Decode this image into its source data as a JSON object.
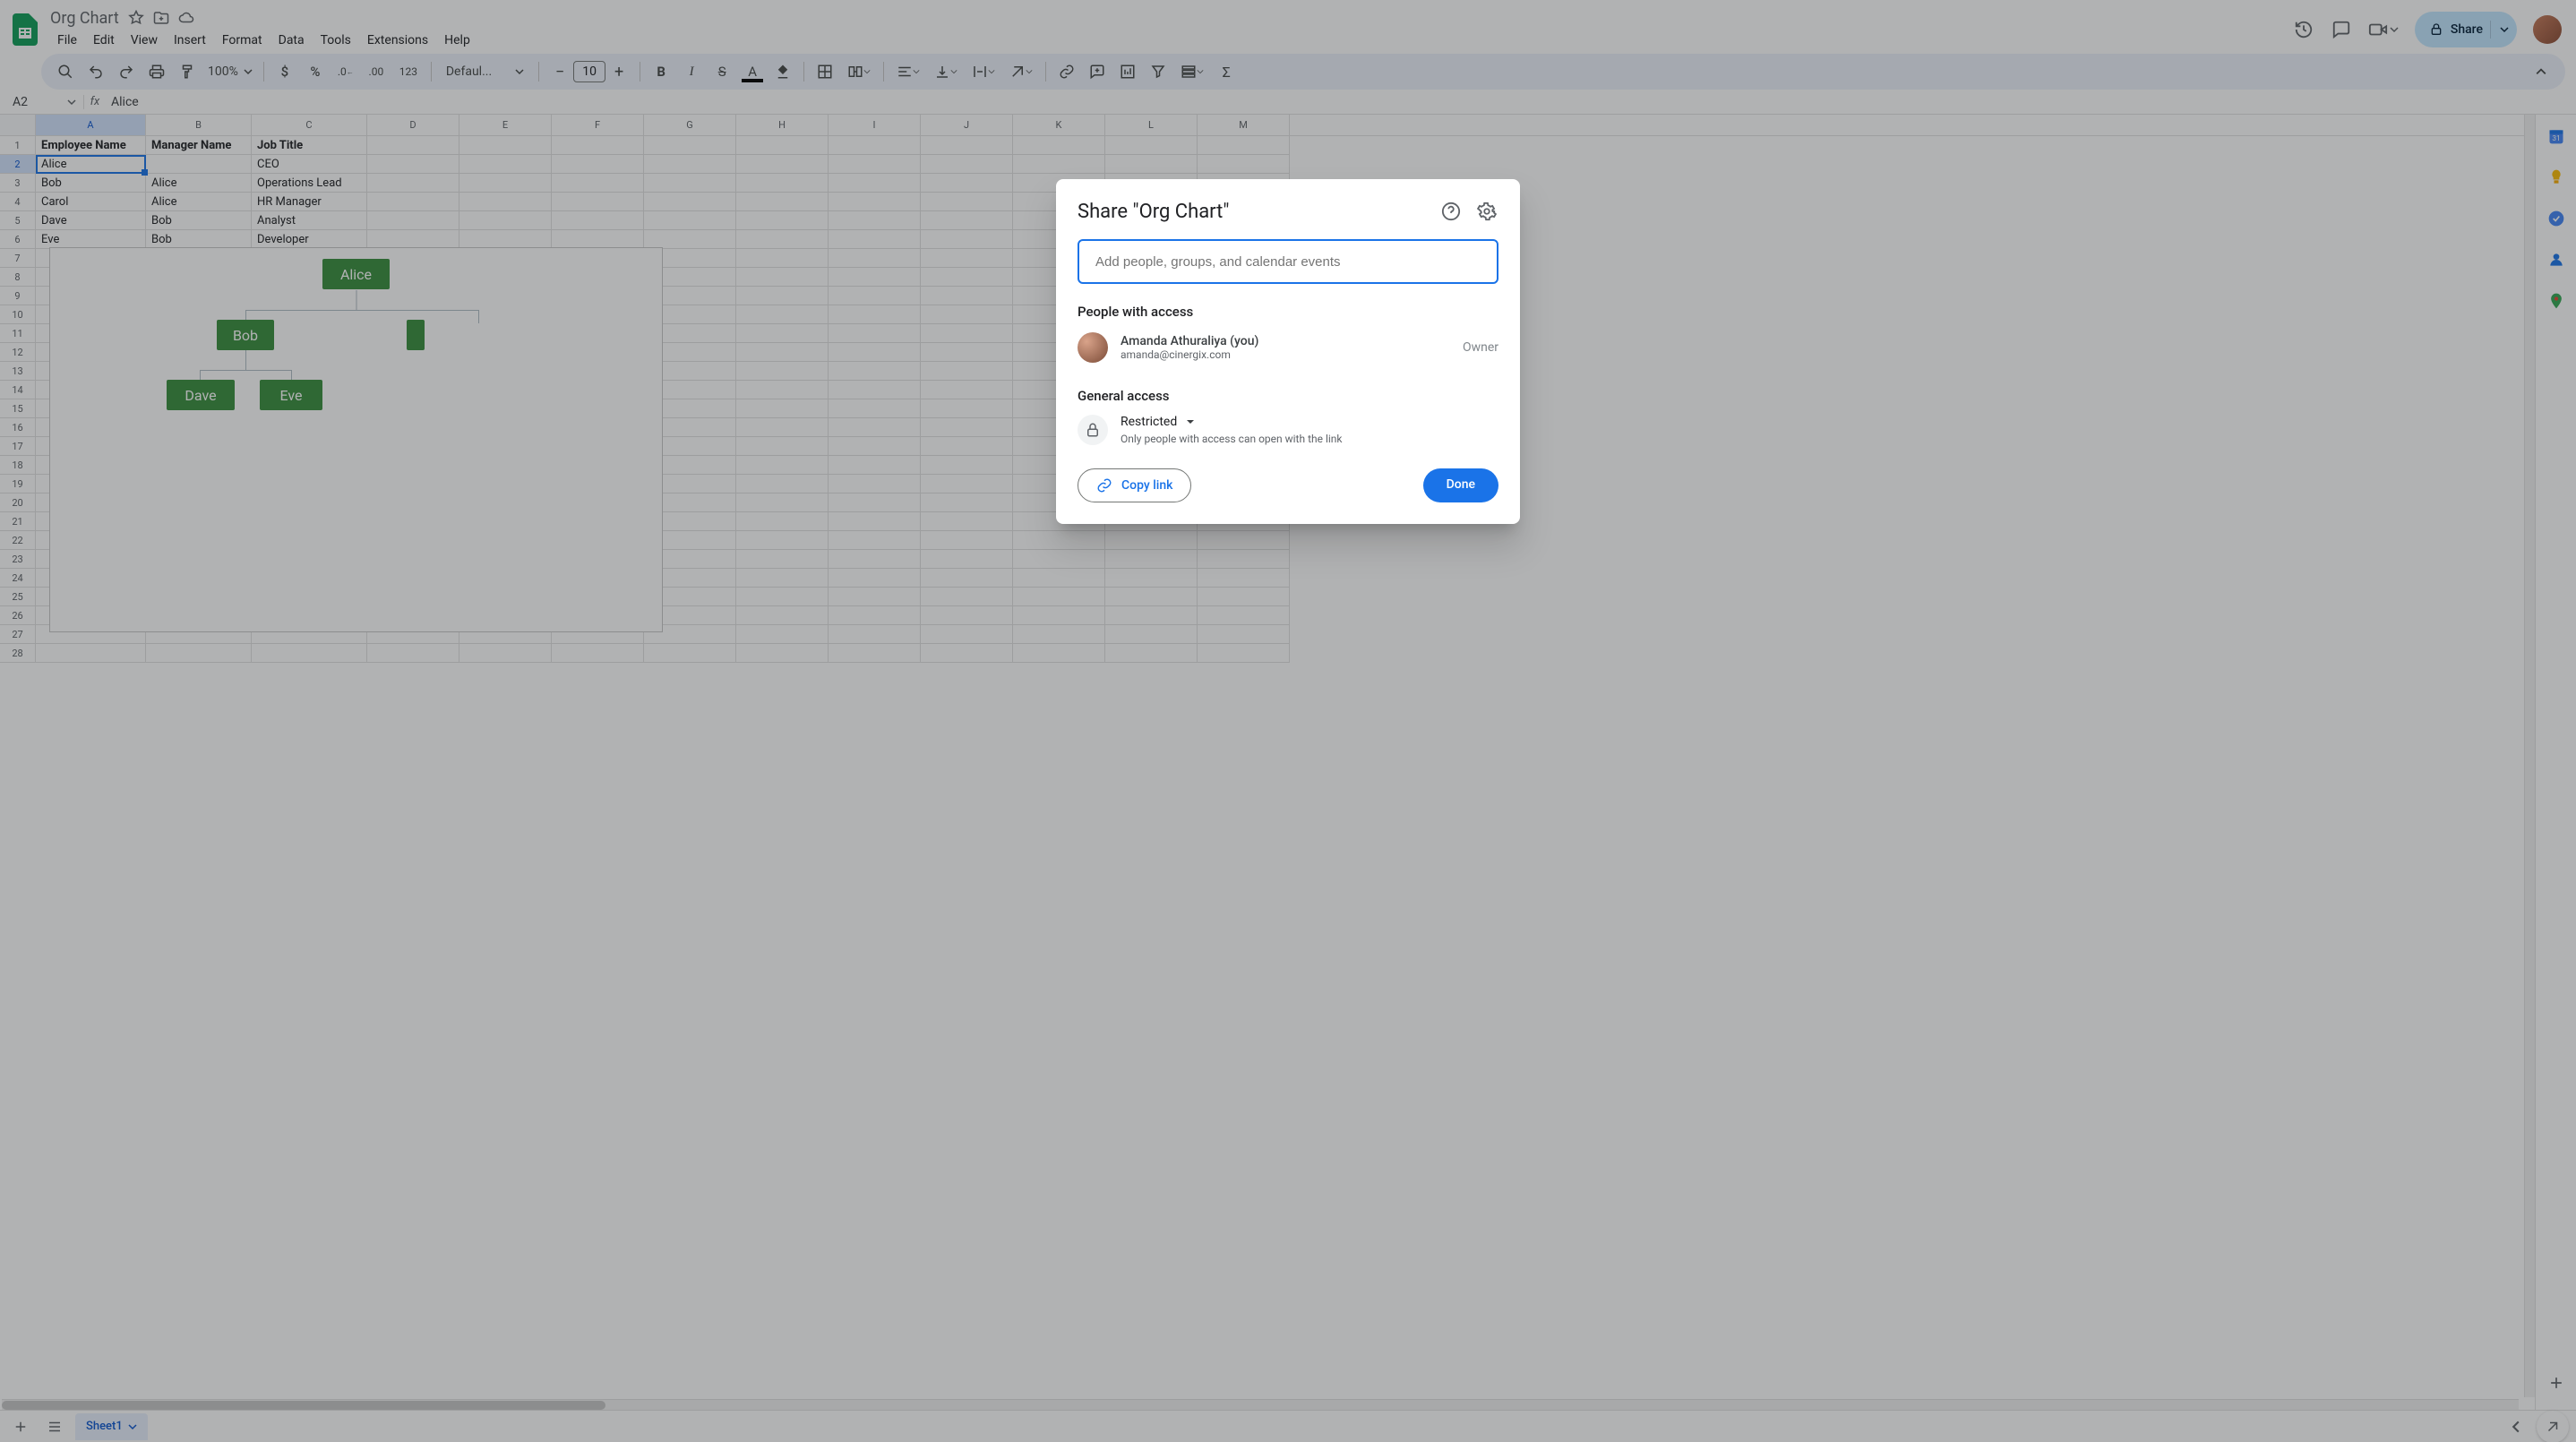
{
  "doc": {
    "title": "Org Chart"
  },
  "menus": {
    "file": "File",
    "edit": "Edit",
    "view": "View",
    "insert": "Insert",
    "format": "Format",
    "data": "Data",
    "tools": "Tools",
    "extensions": "Extensions",
    "help": "Help"
  },
  "share": {
    "label": "Share"
  },
  "toolbar": {
    "zoom": "100%",
    "font": "Defaul...",
    "font_size": "10"
  },
  "namebox": "A2",
  "formula_value": "Alice",
  "columns": [
    "A",
    "B",
    "C",
    "D",
    "E",
    "F",
    "G",
    "H",
    "I",
    "J",
    "K",
    "L",
    "M"
  ],
  "table": {
    "headers": [
      "Employee Name",
      "Manager Name",
      "Job Title"
    ],
    "rows": [
      [
        "Alice",
        "",
        "CEO"
      ],
      [
        "Bob",
        "Alice",
        "Operations Lead"
      ],
      [
        "Carol",
        "Alice",
        "HR Manager"
      ],
      [
        "Dave",
        "Bob",
        "Analyst"
      ],
      [
        "Eve",
        "Bob",
        "Developer"
      ]
    ]
  },
  "chart_data": {
    "type": "orgchart",
    "nodes": {
      "Alice": null,
      "Bob": "Alice",
      "Carol": "Alice",
      "Dave": "Bob",
      "Eve": "Bob"
    },
    "visible": [
      "Alice",
      "Bob",
      "Dave",
      "Eve"
    ]
  },
  "sheet_tab": "Sheet1",
  "dialog": {
    "title": "Share \"Org Chart\"",
    "placeholder": "Add people, groups, and calendar events",
    "people_title": "People with access",
    "person_name": "Amanda Athuraliya (you)",
    "person_email": "amanda@cinergix.com",
    "role": "Owner",
    "ga_title": "General access",
    "restricted": "Restricted",
    "ga_desc": "Only people with access can open with the link",
    "copy": "Copy link",
    "done": "Done"
  }
}
